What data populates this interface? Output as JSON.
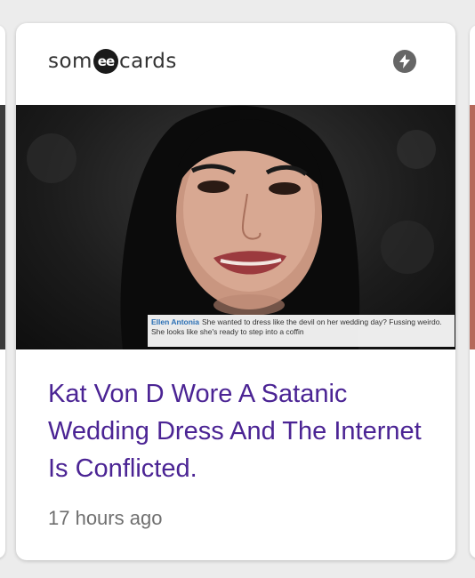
{
  "card": {
    "source": {
      "logo_prefix": "som",
      "logo_mark": "ee",
      "logo_suffix": "cards",
      "amp_icon": "lightning-bolt-icon"
    },
    "image": {
      "caption_author": "Ellen Antonia",
      "caption_text": "She wanted to dress like the devil on her wedding day? Fussing weirdo. She looks like she's ready to step into a coffin"
    },
    "headline": "Kat Von D Wore A Satanic Wedding Dress And The Internet Is Conflicted.",
    "timestamp": "17 hours ago"
  },
  "colors": {
    "headline": "#4b2494",
    "timestamp": "#6f6f6f",
    "amp_badge": "#666666",
    "caption_author": "#2a6fb5"
  }
}
